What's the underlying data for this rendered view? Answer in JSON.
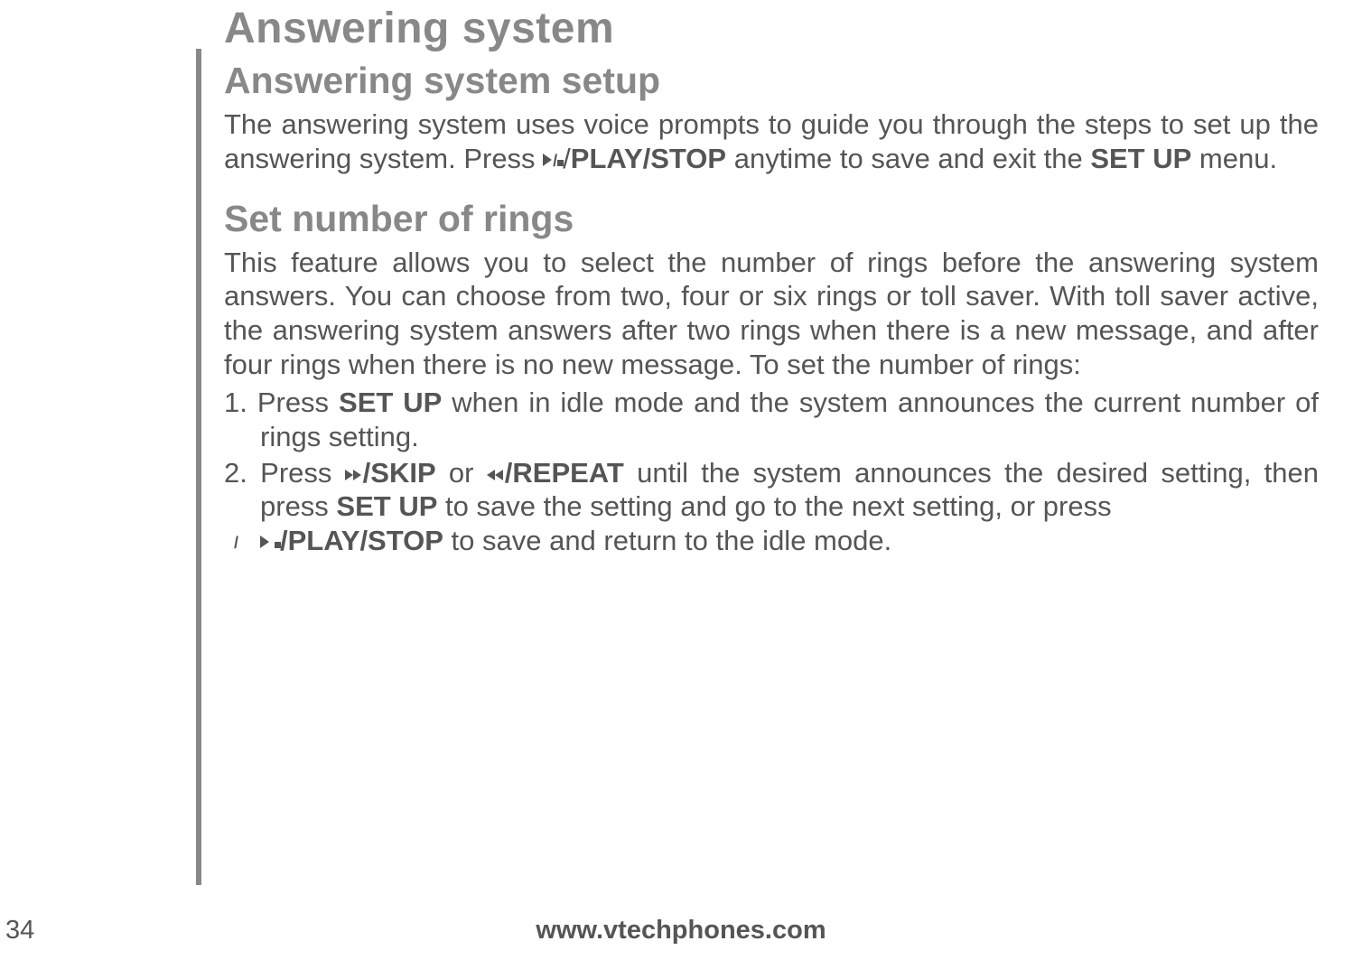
{
  "chapter_title": "Answering system",
  "sections": {
    "setup": {
      "title": "Answering system setup",
      "p1_a": "The answering system uses voice prompts to guide you through the steps to set up the answering system. Press ",
      "p1_b": "/",
      "p1_c": "PLAY/STOP",
      "p1_d": " anytime to save and exit the ",
      "p1_e": "SET UP",
      "p1_f": " menu."
    },
    "rings": {
      "title": "Set number of rings",
      "p1": "This feature allows you to select the number of rings before the answering system answers. You can choose from two, four or six rings or toll saver. With toll saver active, the answering system answers after two rings when there is a new message, and after four rings when there is no new message. To set the number of rings:",
      "step1_num": "1. ",
      "step1_a": "Press ",
      "step1_b": "SET UP",
      "step1_c": " when in idle mode and the system announces the current number of rings setting.",
      "step2_num": "2. ",
      "step2_a": "Press ",
      "step2_b": "/SKIP",
      "step2_c": " or ",
      "step2_d": "/REPEAT",
      "step2_e": " until the system announces the desired setting, then press ",
      "step2_f": "SET UP",
      "step2_g": " to save the setting and go to the next setting,  or press ",
      "step2_h": "/PLAY/STOP",
      "step2_i": " to save and return to the idle mode."
    }
  },
  "footer": {
    "url": "www.vtechphones.com",
    "page_number": "34"
  }
}
